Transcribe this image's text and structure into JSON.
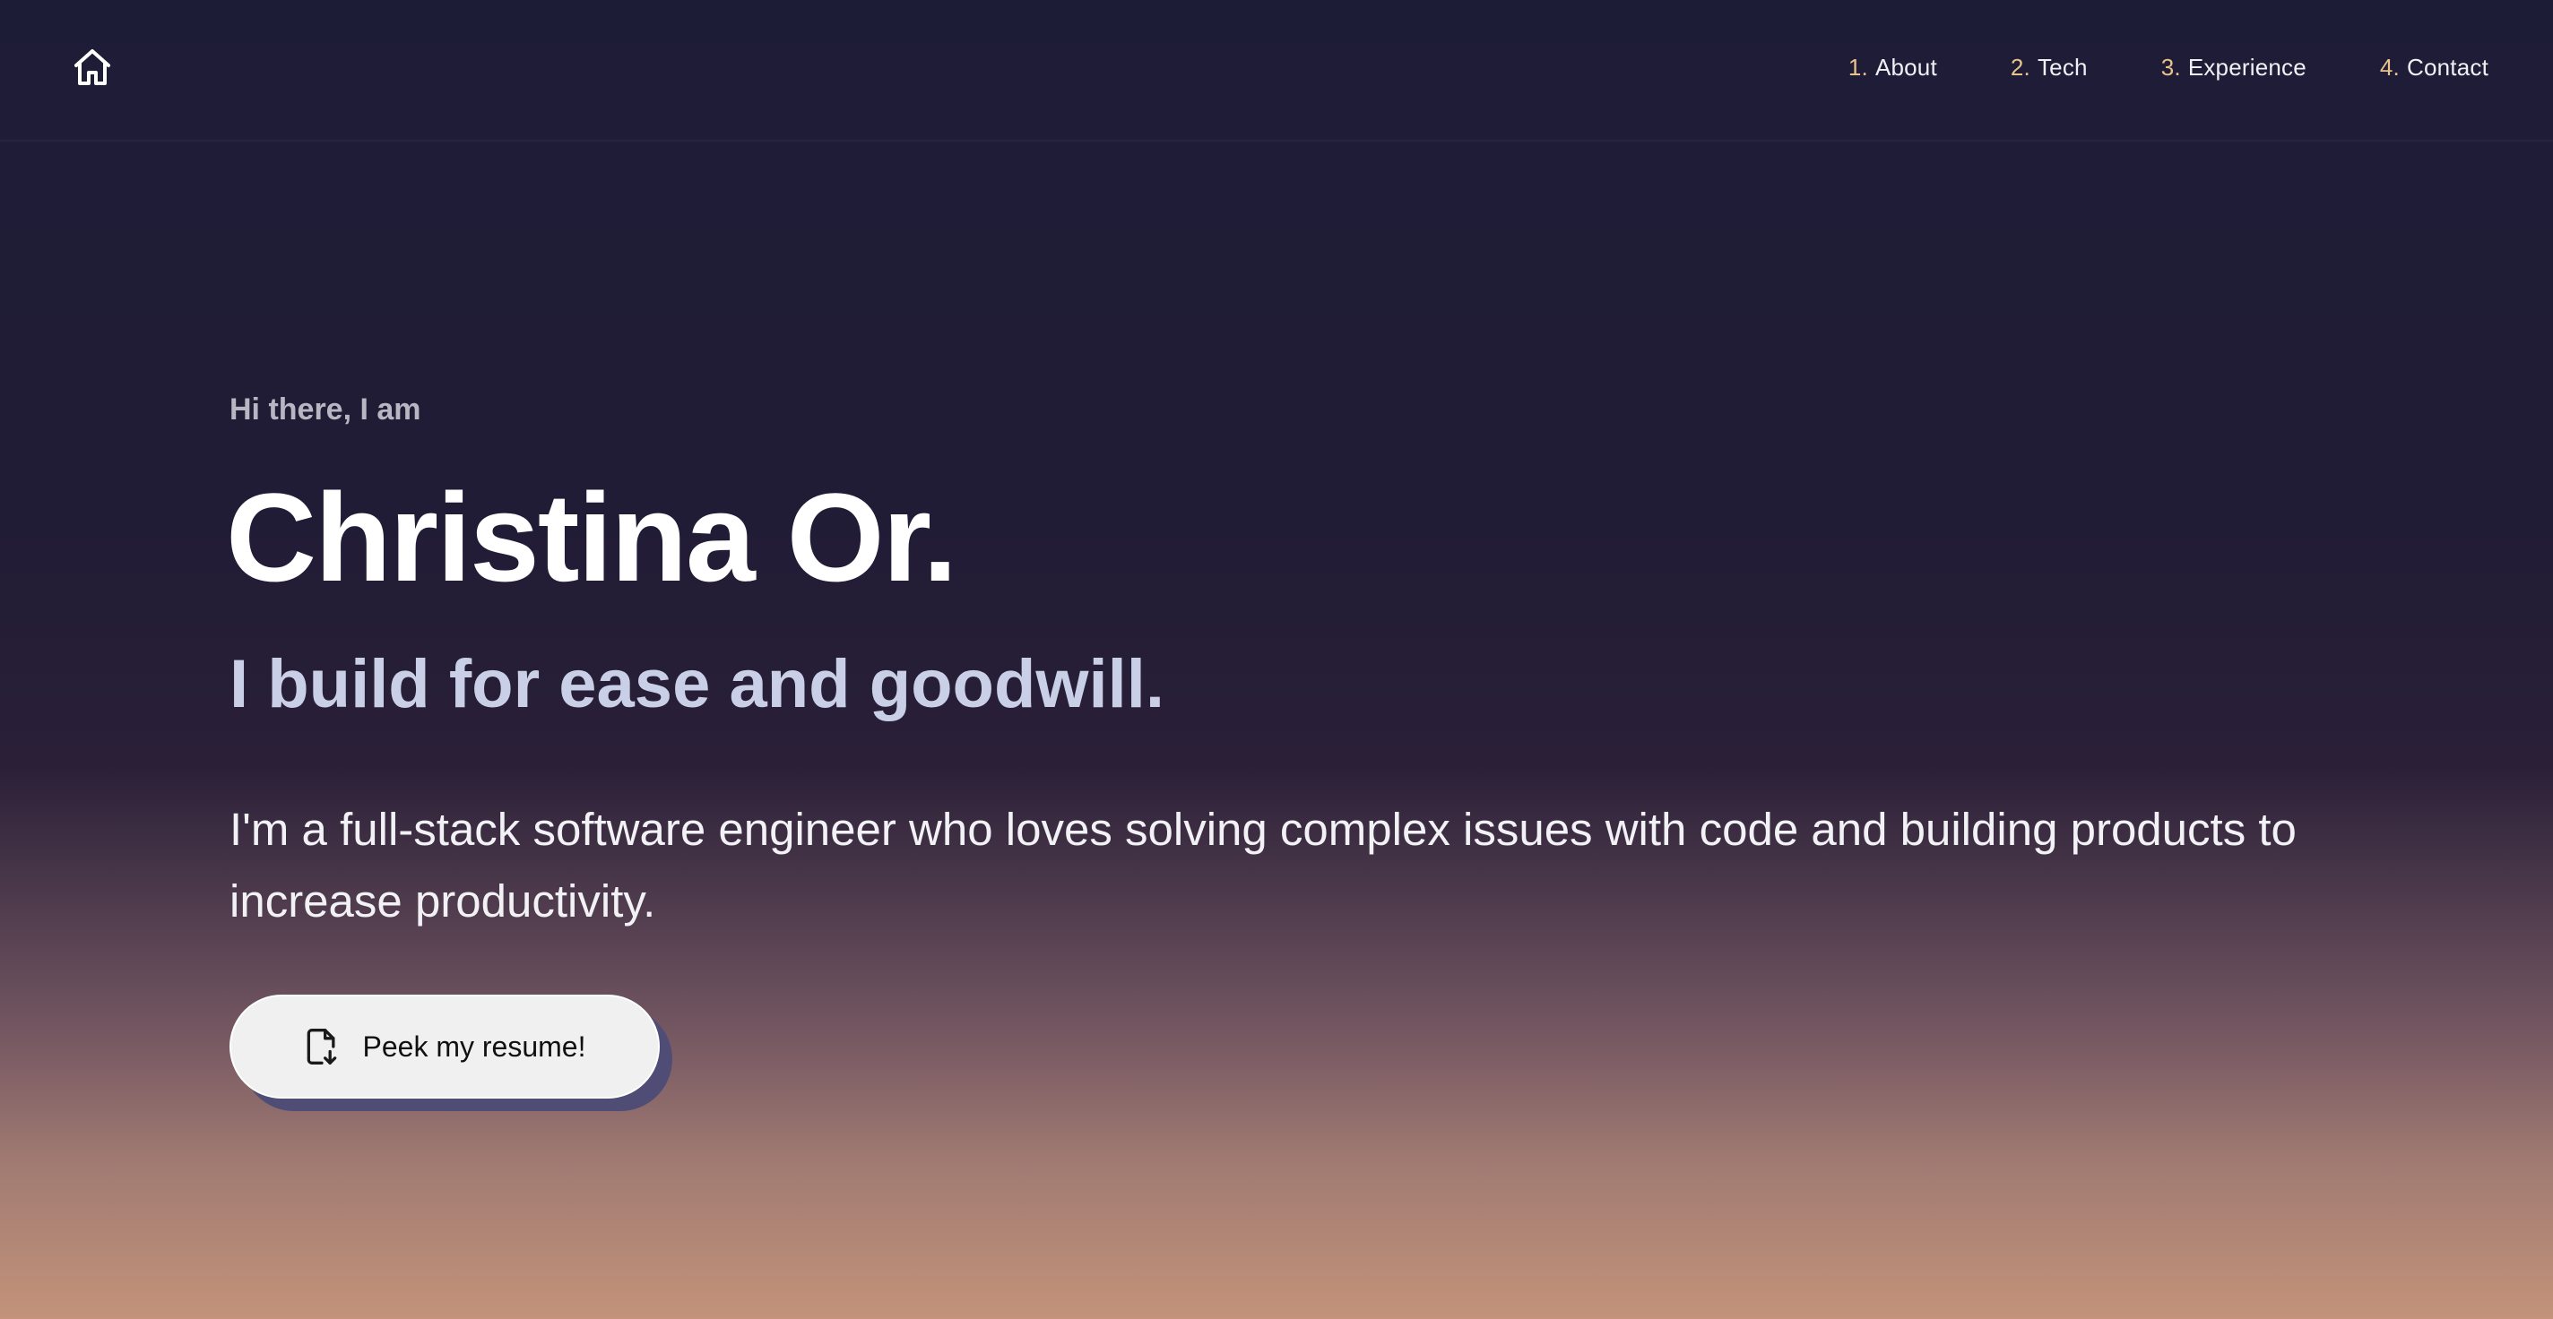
{
  "nav": {
    "home_icon": "home-icon",
    "items": [
      {
        "num": "1.",
        "label": "About"
      },
      {
        "num": "2.",
        "label": "Tech"
      },
      {
        "num": "3.",
        "label": "Experience"
      },
      {
        "num": "4.",
        "label": "Contact"
      }
    ],
    "accent_color": "#e8c48c"
  },
  "hero": {
    "greeting": "Hi there, I am",
    "name": "Christina Or.",
    "tagline": "I build for ease and goodwill.",
    "bio": "I'm a full-stack software engineer who loves solving complex issues with code and building products to increase productivity.",
    "resume_button": {
      "icon": "file-download-icon",
      "label": "Peek my resume!"
    }
  }
}
